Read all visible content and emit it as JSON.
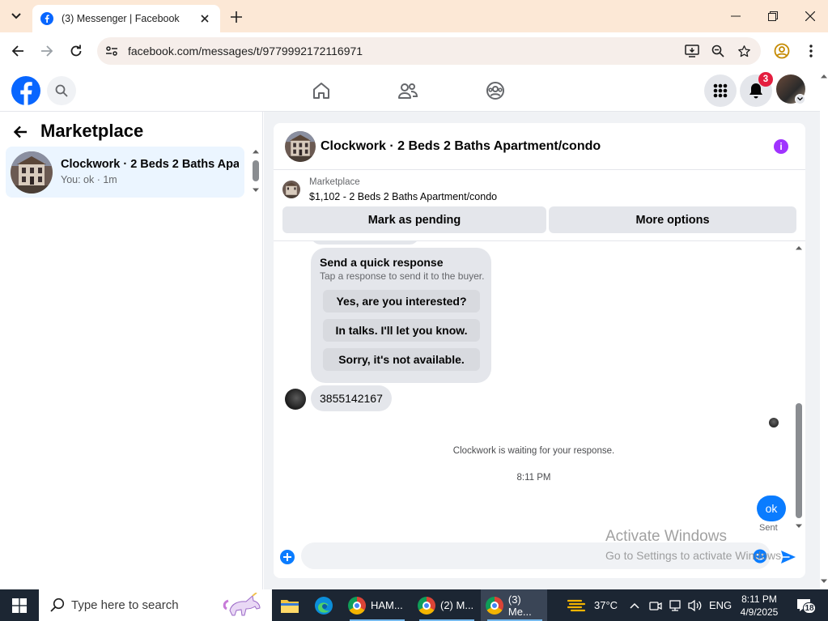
{
  "browser": {
    "tab_title": "(3) Messenger | Facebook",
    "url": "facebook.com/messages/t/9779992172116971"
  },
  "fb_header": {
    "notification_count": "3"
  },
  "left_panel": {
    "title": "Marketplace",
    "conversations": [
      {
        "name": "Clockwork · 2 Beds 2 Baths Apar...",
        "preview": "You: ok · 1m"
      }
    ]
  },
  "chat": {
    "title": "Clockwork · 2 Beds 2 Baths Apartment/condo",
    "listing": {
      "label": "Marketplace",
      "description": "$1,102 - 2 Beds 2 Baths Apartment/condo"
    },
    "actions": {
      "mark_pending": "Mark as pending",
      "more_options": "More options"
    },
    "quick_response": {
      "title": "Send a quick response",
      "subtitle": "Tap a response to send it to the buyer.",
      "options": [
        "Yes, are you interested?",
        "In talks. I'll let you know.",
        "Sorry, it's not available."
      ]
    },
    "incoming_message": "3855142167",
    "waiting_text": "Clockwork is waiting for your response.",
    "timestamp": "8:11 PM",
    "outgoing_message": "ok",
    "sent_status": "Sent",
    "composer_value": ""
  },
  "watermark": {
    "line1": "Activate Windows",
    "line2": "Go to Settings to activate Windows."
  },
  "taskbar": {
    "search_placeholder": "Type here to search",
    "apps": [
      "HAM...",
      "(2) M...",
      "(3) Me..."
    ],
    "weather": "37°C",
    "language": "ENG",
    "time": "8:11 PM",
    "date": "4/9/2025",
    "notifications": "18"
  },
  "colors": {
    "fb_blue": "#0866ff",
    "messenger_blue": "#0a7cff",
    "info_purple": "#a033ff",
    "badge_red": "#e41e3f"
  }
}
